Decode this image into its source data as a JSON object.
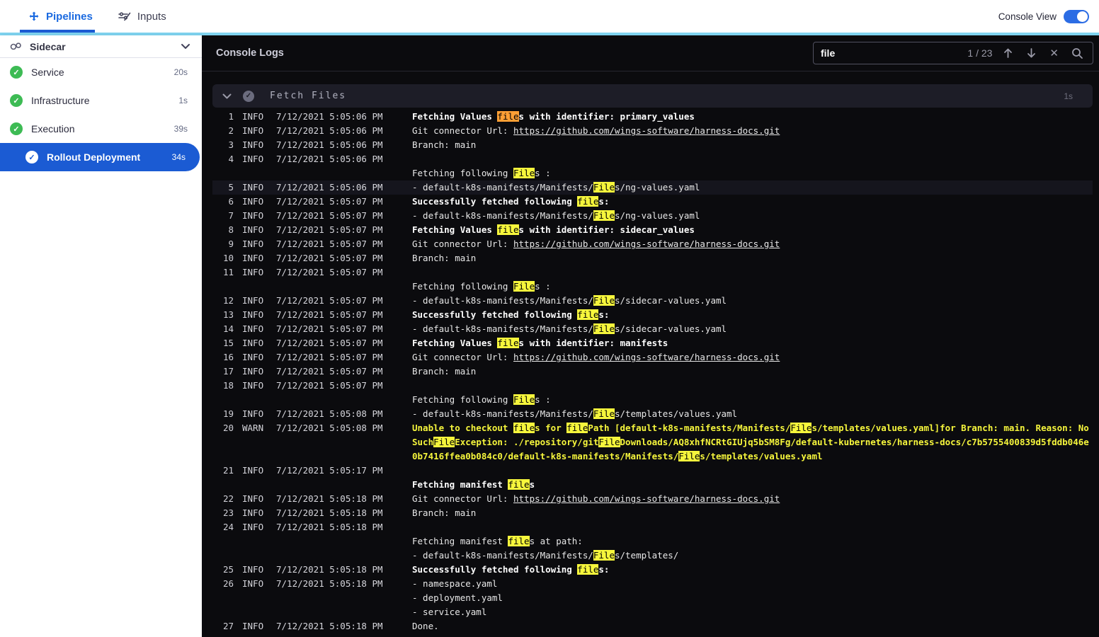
{
  "header": {
    "tabs": [
      {
        "label": "Pipelines"
      },
      {
        "label": "Inputs"
      }
    ],
    "console_view_label": "Console View",
    "console_view_on": true
  },
  "sidebar": {
    "title": "Sidecar",
    "items": [
      {
        "label": "Service",
        "duration": "20s",
        "status": "success"
      },
      {
        "label": "Infrastructure",
        "duration": "1s",
        "status": "success"
      },
      {
        "label": "Execution",
        "duration": "39s",
        "status": "success"
      },
      {
        "label": "Rollout Deployment",
        "duration": "34s",
        "status": "success",
        "selected": true
      }
    ]
  },
  "console": {
    "title": "Console Logs",
    "search": {
      "value": "file",
      "counter": "1 / 23"
    },
    "section": {
      "title": "Fetch Files",
      "duration": "1s"
    }
  },
  "colors": {
    "accent_blue": "#1b5bd3",
    "cyan_strip": "#7fd3ef",
    "success_green": "#3dbb54",
    "highlight_yellow": "#f6f63c",
    "highlight_active_orange": "#ff9f35",
    "warn_text": "#f6f63c",
    "console_bg": "#0b0b0e"
  },
  "logs": [
    {
      "n": "1",
      "lv": "INFO",
      "ts": "7/12/2021 5:05:06 PM",
      "segs": [
        [
          "Fetching Values ",
          "b"
        ],
        [
          "file",
          "a"
        ],
        [
          "s with identifier: primary_values",
          "b"
        ]
      ]
    },
    {
      "n": "2",
      "lv": "INFO",
      "ts": "7/12/2021 5:05:06 PM",
      "segs": [
        [
          "Git connector Url: ",
          ""
        ],
        [
          "https://github.com/wings-software/harness-docs.git",
          "l"
        ]
      ]
    },
    {
      "n": "3",
      "lv": "INFO",
      "ts": "7/12/2021 5:05:06 PM",
      "segs": [
        [
          "Branch: main",
          ""
        ]
      ]
    },
    {
      "n": "4",
      "lv": "INFO",
      "ts": "7/12/2021 5:05:06 PM",
      "segs": []
    },
    {
      "segs": [
        [
          "Fetching following ",
          ""
        ],
        [
          "File",
          "h"
        ],
        [
          "s :",
          ""
        ]
      ]
    },
    {
      "n": "5",
      "lv": "INFO",
      "ts": "7/12/2021 5:05:06 PM",
      "sel": true,
      "segs": [
        [
          "- default-k8s-manifests/Manifests/",
          ""
        ],
        [
          "File",
          "h"
        ],
        [
          "s/ng-values.yaml",
          ""
        ]
      ]
    },
    {
      "n": "6",
      "lv": "INFO",
      "ts": "7/12/2021 5:05:07 PM",
      "segs": [
        [
          "Successfully fetched following ",
          "b"
        ],
        [
          "file",
          "h"
        ],
        [
          "s:",
          "b"
        ]
      ]
    },
    {
      "n": "7",
      "lv": "INFO",
      "ts": "7/12/2021 5:05:07 PM",
      "segs": [
        [
          "- default-k8s-manifests/Manifests/",
          ""
        ],
        [
          "File",
          "h"
        ],
        [
          "s/ng-values.yaml",
          ""
        ]
      ]
    },
    {
      "n": "8",
      "lv": "INFO",
      "ts": "7/12/2021 5:05:07 PM",
      "segs": [
        [
          "Fetching Values ",
          "b"
        ],
        [
          "file",
          "h"
        ],
        [
          "s with identifier: sidecar_values",
          "b"
        ]
      ]
    },
    {
      "n": "9",
      "lv": "INFO",
      "ts": "7/12/2021 5:05:07 PM",
      "segs": [
        [
          "Git connector Url: ",
          ""
        ],
        [
          "https://github.com/wings-software/harness-docs.git",
          "l"
        ]
      ]
    },
    {
      "n": "10",
      "lv": "INFO",
      "ts": "7/12/2021 5:05:07 PM",
      "segs": [
        [
          "Branch: main",
          ""
        ]
      ]
    },
    {
      "n": "11",
      "lv": "INFO",
      "ts": "7/12/2021 5:05:07 PM",
      "segs": []
    },
    {
      "segs": [
        [
          "Fetching following ",
          ""
        ],
        [
          "File",
          "h"
        ],
        [
          "s :",
          ""
        ]
      ]
    },
    {
      "n": "12",
      "lv": "INFO",
      "ts": "7/12/2021 5:05:07 PM",
      "segs": [
        [
          "- default-k8s-manifests/Manifests/",
          ""
        ],
        [
          "File",
          "h"
        ],
        [
          "s/sidecar-values.yaml",
          ""
        ]
      ]
    },
    {
      "n": "13",
      "lv": "INFO",
      "ts": "7/12/2021 5:05:07 PM",
      "segs": [
        [
          "Successfully fetched following ",
          "b"
        ],
        [
          "file",
          "h"
        ],
        [
          "s:",
          "b"
        ]
      ]
    },
    {
      "n": "14",
      "lv": "INFO",
      "ts": "7/12/2021 5:05:07 PM",
      "segs": [
        [
          "- default-k8s-manifests/Manifests/",
          ""
        ],
        [
          "File",
          "h"
        ],
        [
          "s/sidecar-values.yaml",
          ""
        ]
      ]
    },
    {
      "n": "15",
      "lv": "INFO",
      "ts": "7/12/2021 5:05:07 PM",
      "segs": [
        [
          "Fetching Values ",
          "b"
        ],
        [
          "file",
          "h"
        ],
        [
          "s with identifier: manifests",
          "b"
        ]
      ]
    },
    {
      "n": "16",
      "lv": "INFO",
      "ts": "7/12/2021 5:05:07 PM",
      "segs": [
        [
          "Git connector Url: ",
          ""
        ],
        [
          "https://github.com/wings-software/harness-docs.git",
          "l"
        ]
      ]
    },
    {
      "n": "17",
      "lv": "INFO",
      "ts": "7/12/2021 5:05:07 PM",
      "segs": [
        [
          "Branch: main",
          ""
        ]
      ]
    },
    {
      "n": "18",
      "lv": "INFO",
      "ts": "7/12/2021 5:05:07 PM",
      "segs": []
    },
    {
      "segs": [
        [
          "Fetching following ",
          ""
        ],
        [
          "File",
          "h"
        ],
        [
          "s :",
          ""
        ]
      ]
    },
    {
      "n": "19",
      "lv": "INFO",
      "ts": "7/12/2021 5:05:08 PM",
      "segs": [
        [
          "- default-k8s-manifests/Manifests/",
          ""
        ],
        [
          "File",
          "h"
        ],
        [
          "s/templates/values.yaml",
          ""
        ]
      ]
    },
    {
      "n": "20",
      "lv": "WARN",
      "ts": "7/12/2021 5:05:08 PM",
      "segs": [
        [
          "Unable to checkout ",
          "w"
        ],
        [
          "file",
          "h"
        ],
        [
          "s for ",
          "w"
        ],
        [
          "file",
          "h"
        ],
        [
          "Path [default-k8s-manifests/Manifests/",
          "w"
        ],
        [
          "File",
          "h"
        ],
        [
          "s/templates/values.yaml]for Branch: main. Reason: NoSuch",
          "w"
        ],
        [
          "File",
          "h"
        ],
        [
          "Exception: ./repository/git",
          "w"
        ],
        [
          "File",
          "h"
        ],
        [
          "Downloads/AQ8xhfNCRtGIUjq5bSM8Fg/default-kubernetes/harness-docs/c7b5755400839d5fddb046e0b7416ffea0b084c0/default-k8s-manifests/Manifests/",
          "w"
        ],
        [
          "File",
          "h"
        ],
        [
          "s/templates/values.yaml",
          "w"
        ]
      ]
    },
    {
      "n": "21",
      "lv": "INFO",
      "ts": "7/12/2021 5:05:17 PM",
      "segs": []
    },
    {
      "segs": [
        [
          "Fetching manifest ",
          "b"
        ],
        [
          "file",
          "h"
        ],
        [
          "s",
          "b"
        ]
      ]
    },
    {
      "n": "22",
      "lv": "INFO",
      "ts": "7/12/2021 5:05:18 PM",
      "segs": [
        [
          "Git connector Url: ",
          ""
        ],
        [
          "https://github.com/wings-software/harness-docs.git",
          "l"
        ]
      ]
    },
    {
      "n": "23",
      "lv": "INFO",
      "ts": "7/12/2021 5:05:18 PM",
      "segs": [
        [
          "Branch: main",
          ""
        ]
      ]
    },
    {
      "n": "24",
      "lv": "INFO",
      "ts": "7/12/2021 5:05:18 PM",
      "segs": []
    },
    {
      "segs": [
        [
          "Fetching manifest ",
          ""
        ],
        [
          "file",
          "h"
        ],
        [
          "s at path:",
          ""
        ]
      ]
    },
    {
      "segs": [
        [
          "- default-k8s-manifests/Manifests/",
          ""
        ],
        [
          "File",
          "h"
        ],
        [
          "s/templates/",
          ""
        ]
      ]
    },
    {
      "n": "25",
      "lv": "INFO",
      "ts": "7/12/2021 5:05:18 PM",
      "segs": [
        [
          "Successfully fetched following ",
          "b"
        ],
        [
          "file",
          "h"
        ],
        [
          "s:",
          "b"
        ]
      ]
    },
    {
      "n": "26",
      "lv": "INFO",
      "ts": "7/12/2021 5:05:18 PM",
      "segs": [
        [
          "- namespace.yaml",
          ""
        ]
      ]
    },
    {
      "segs": [
        [
          "- deployment.yaml",
          ""
        ]
      ]
    },
    {
      "segs": [
        [
          "- service.yaml",
          ""
        ]
      ]
    },
    {
      "n": "27",
      "lv": "INFO",
      "ts": "7/12/2021 5:05:18 PM",
      "segs": [
        [
          "Done.",
          ""
        ]
      ]
    }
  ]
}
